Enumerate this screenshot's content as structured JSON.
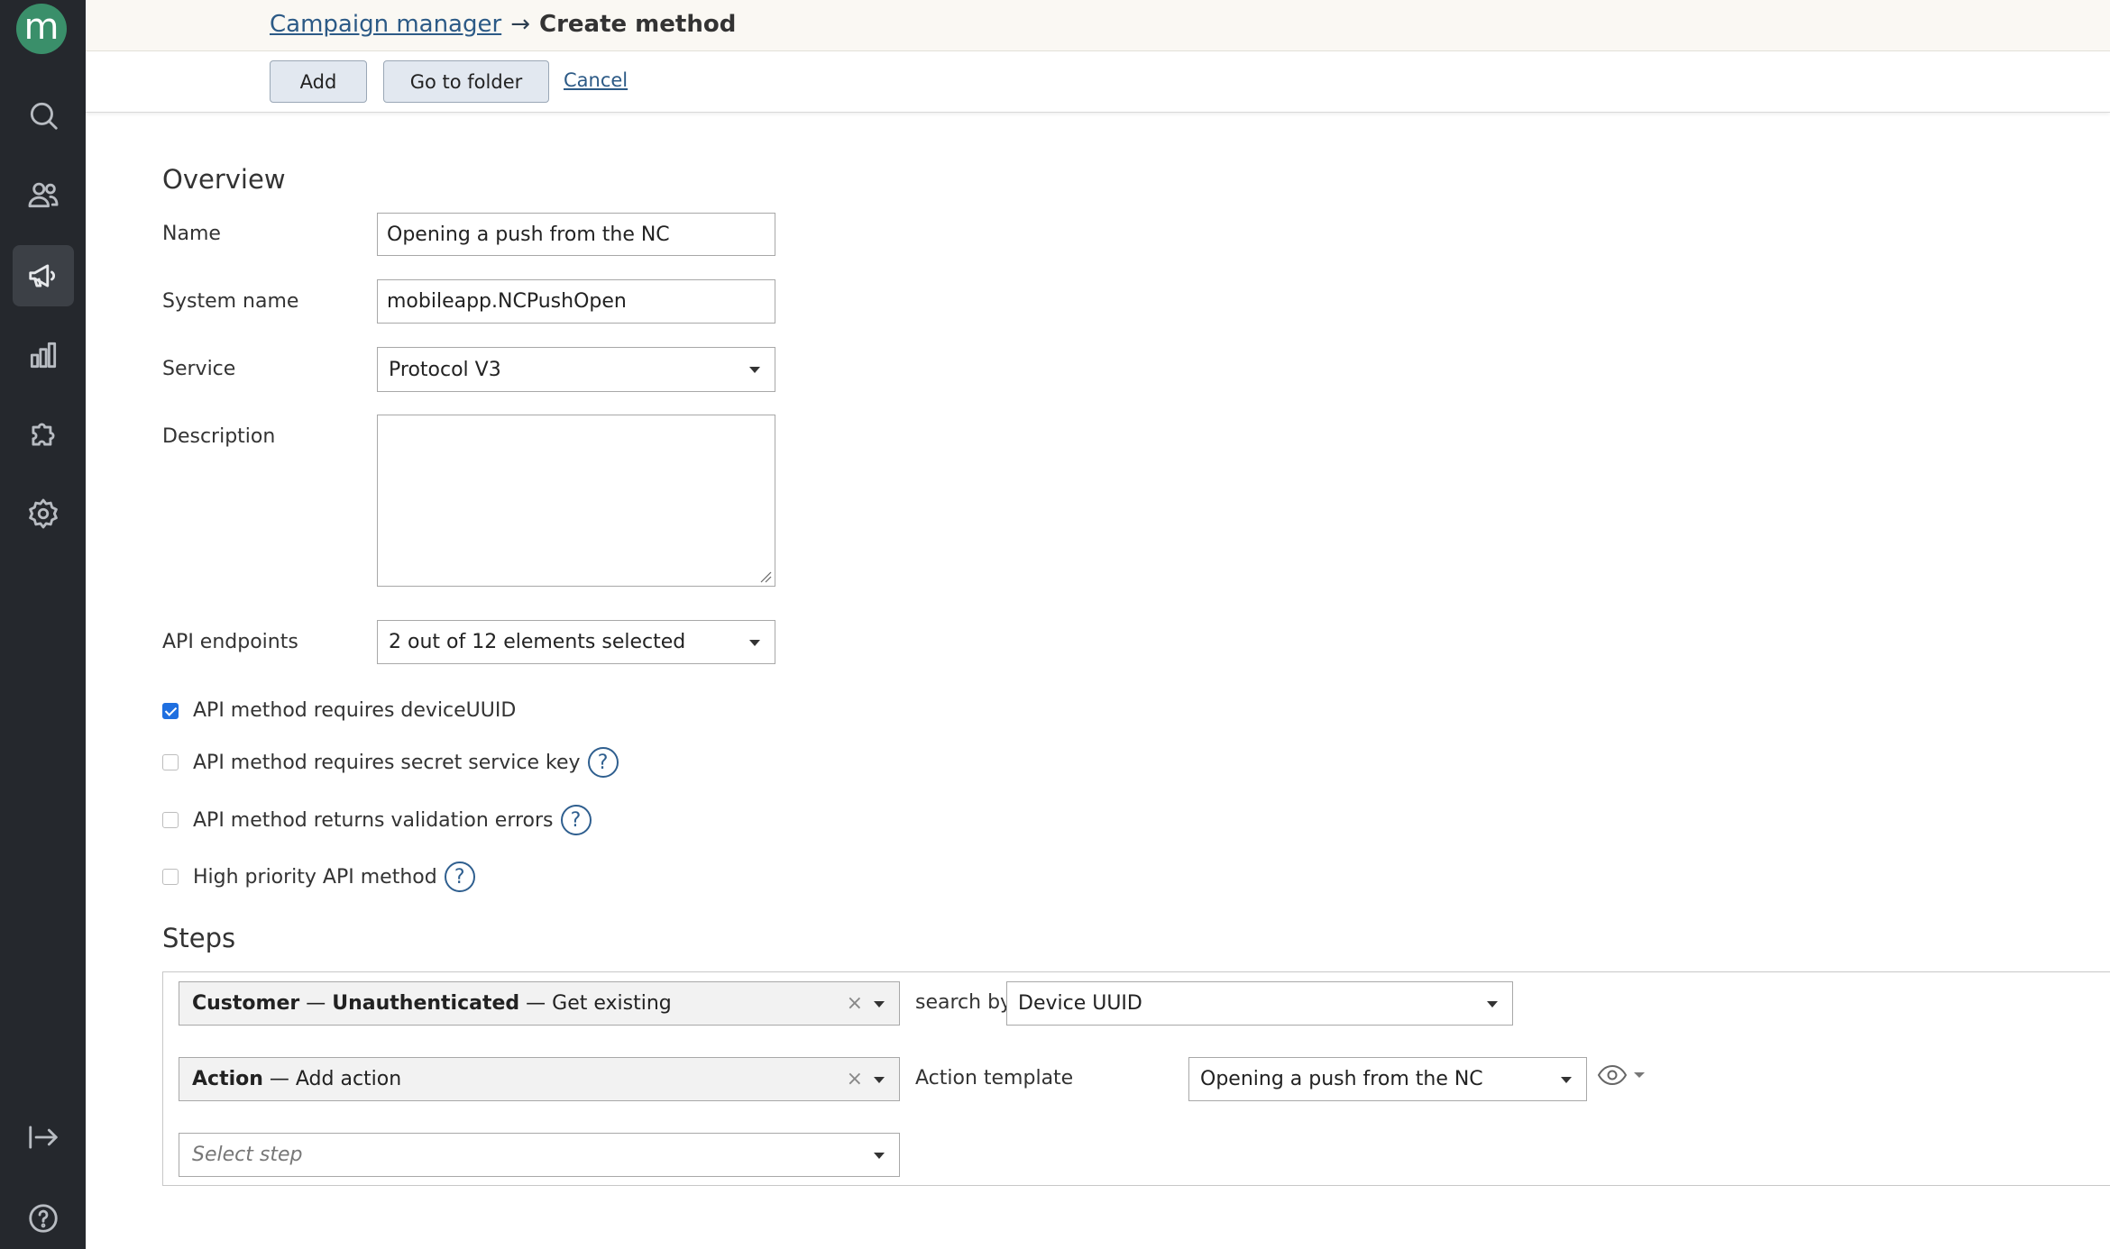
{
  "sidebar": {
    "logo_letter": "m",
    "items": [
      {
        "icon": "search-icon"
      },
      {
        "icon": "users-icon"
      },
      {
        "icon": "megaphone-icon",
        "active": true
      },
      {
        "icon": "bar-chart-icon"
      },
      {
        "icon": "puzzle-icon"
      },
      {
        "icon": "settings-icon"
      }
    ],
    "bottom": [
      {
        "icon": "logout-icon"
      },
      {
        "icon": "help-circle-icon"
      }
    ]
  },
  "header": {
    "breadcrumb_parent": "Campaign manager",
    "breadcrumb_arrow": "→",
    "breadcrumb_current": "Create method"
  },
  "toolbar": {
    "add_label": "Add",
    "folder_label": "Go to folder",
    "cancel_label": "Cancel"
  },
  "overview": {
    "title": "Overview",
    "name_label": "Name",
    "name_value": "Opening a push from the NC",
    "system_name_label": "System name",
    "system_name_value": "mobileapp.NCPushOpen",
    "service_label": "Service",
    "service_value": "Protocol V3",
    "description_label": "Description",
    "description_value": "",
    "endpoints_label": "API endpoints",
    "endpoints_value": "2 out of 12 elements selected"
  },
  "options": [
    {
      "label": "API method requires deviceUUID",
      "checked": true,
      "help": false
    },
    {
      "label": "API method requires secret service key",
      "checked": false,
      "help": true
    },
    {
      "label": "API method returns validation errors",
      "checked": false,
      "help": true
    },
    {
      "label": "High priority API method",
      "checked": false,
      "help": true
    }
  ],
  "help_glyph": "?",
  "steps": {
    "title": "Steps",
    "step1": {
      "part1": "Customer",
      "sep1": " — ",
      "part2": "Unauthenticated",
      "rest": " — Get existing"
    },
    "search_by_label": "search by",
    "search_by_value": "Device UUID",
    "step2": {
      "part1": "Action",
      "rest": " — Add action"
    },
    "action_template_label": "Action template",
    "action_template_value": "Opening a push from the NC",
    "select_step_placeholder": "Select step",
    "clear_glyph": "×"
  },
  "colors": {
    "sidebar_bg": "#25282d",
    "logo_green": "#3a8f6a",
    "link_blue": "#2c5a86",
    "checkbox_blue": "#1f6fe0"
  }
}
